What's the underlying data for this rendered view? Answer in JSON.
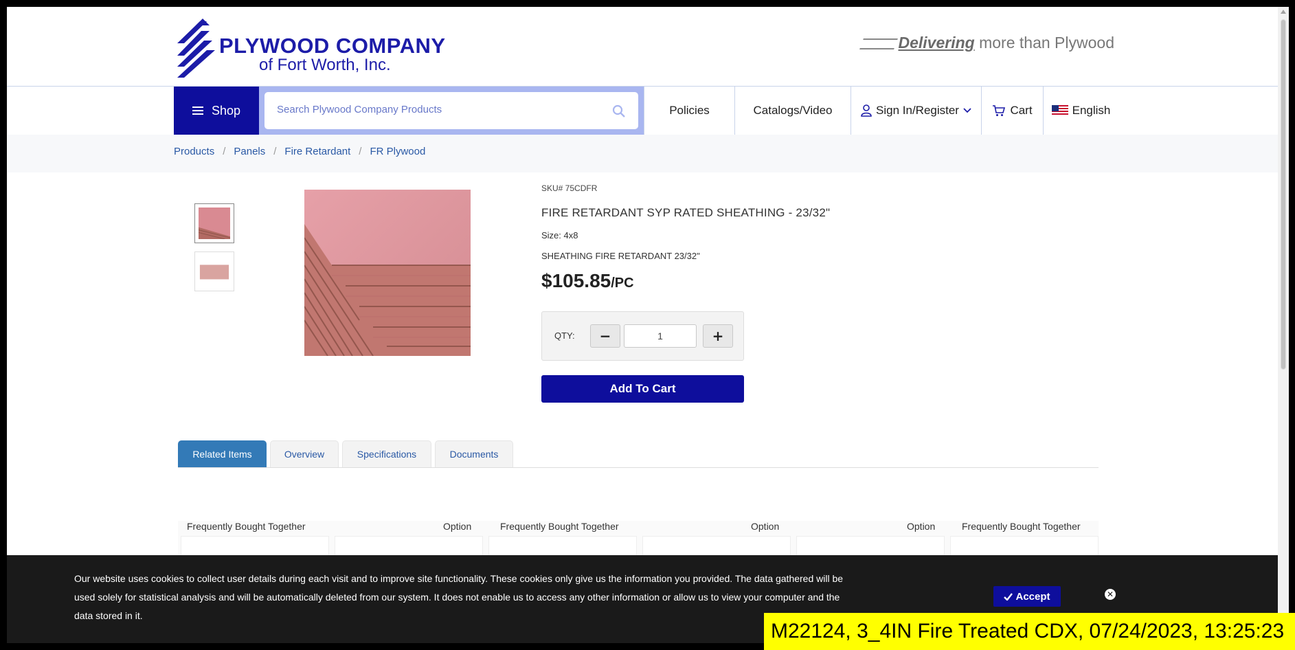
{
  "header": {
    "logo_line1": "PLYWOOD COMPANY",
    "logo_line2": "of Fort Worth, Inc.",
    "tagline_em": "Delivering",
    "tagline_rest": " more than Plywood"
  },
  "nav": {
    "shop_label": "Shop",
    "search_placeholder": "Search Plywood Company Products",
    "policies": "Policies",
    "catalogs": "Catalogs/Video",
    "signin": "Sign In/Register",
    "cart": "Cart",
    "language": "English"
  },
  "breadcrumb": [
    "Products",
    "Panels",
    "Fire Retardant",
    "FR Plywood"
  ],
  "product": {
    "sku": "SKU# 75CDFR",
    "title": "FIRE RETARDANT SYP RATED SHEATHING - 23/32\"",
    "size": "Size: 4x8",
    "description": "SHEATHING FIRE RETARDANT 23/32\"",
    "price": "$105.85",
    "unit": "/PC",
    "qty_label": "QTY:",
    "qty_value": "1",
    "minus": "−",
    "plus": "+",
    "add_to_cart": "Add To Cart"
  },
  "tabs": [
    "Related Items",
    "Overview",
    "Specifications",
    "Documents"
  ],
  "related_headers": [
    "Frequently Bought Together",
    "Option",
    "Frequently Bought Together",
    "Option",
    "Option",
    "Frequently Bought Together"
  ],
  "cookie": {
    "text": "Our website uses cookies to collect user details during each visit and to improve site functionality. These cookies only give us the information you provided. The data gathered will be used solely for statistical analysis and will be automatically deleted from our system. It does not enable us to access any other information or allow us to view your computer and the data stored in it.",
    "accept": "Accept"
  },
  "caption": "M22124, 3_4IN Fire Treated CDX, 07/24/2023, 13:25:23",
  "colors": {
    "brand_blue": "#0e0e9c",
    "tab_active": "#337ab7",
    "link": "#2a59a5",
    "cookie_bg": "#1a1a1a",
    "caption_bg": "#ffff00"
  }
}
